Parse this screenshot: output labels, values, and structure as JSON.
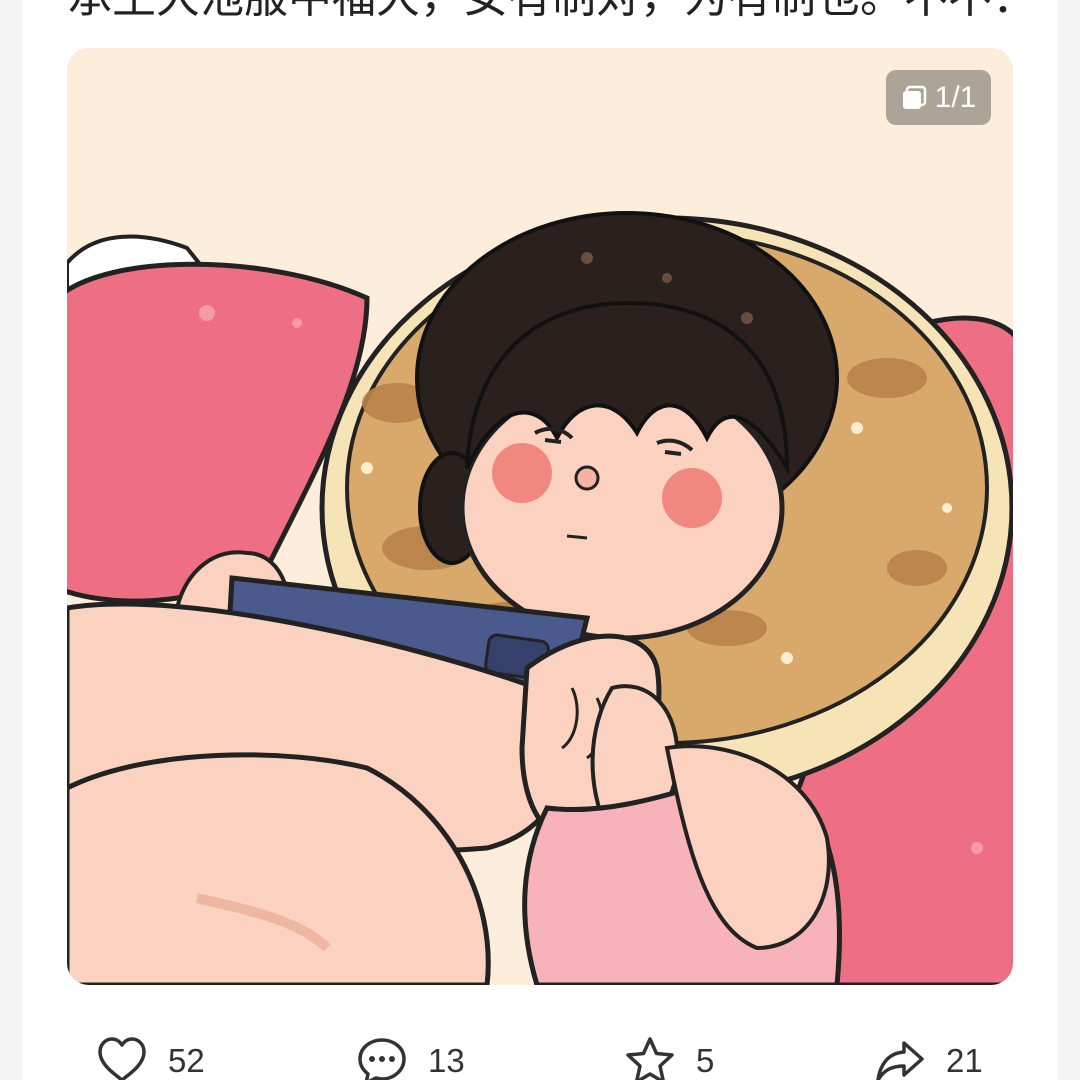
{
  "post": {
    "caption": "承生大池服中福大，女有制对，为有制也。不不：",
    "image_counter": "1/1",
    "image_alt_icon": "illustration-girl-on-phone"
  },
  "actions": {
    "like": {
      "icon": "heart-icon",
      "count": "52"
    },
    "comment": {
      "icon": "comment-bubble-icon",
      "count": "13"
    },
    "favorite": {
      "icon": "star-icon",
      "count": "5"
    },
    "share": {
      "icon": "share-arrow-icon",
      "count": "21"
    }
  },
  "colors": {
    "background": "#f3f3f3",
    "card": "#ffffff",
    "image_bg": "#fdeedb",
    "pillow_pink": "#ee6f84",
    "donut_pillow": "#d8a96a",
    "hair": "#2a211e",
    "skin": "#fbd2c0",
    "phone": "#4b5a8d"
  }
}
